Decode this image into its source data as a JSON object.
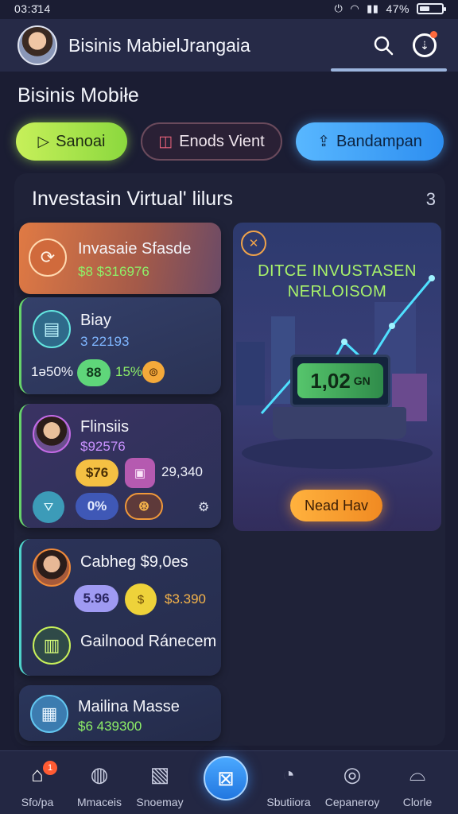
{
  "status_bar": {
    "time": "03:3̄14",
    "battery_text": "47%",
    "battery_level": 0.47
  },
  "app_bar": {
    "title": "Bisinis MabielJrangaia",
    "search_icon": "search-icon",
    "notification_icon": "notification-icon"
  },
  "section_title": "Bisinis Mobiłe",
  "chips": [
    {
      "label": "Sanoai",
      "icon": "play-icon",
      "color": "#a8e64c"
    },
    {
      "label": "Enods Vient",
      "icon": "chart-icon",
      "color": "#6a4a5c"
    },
    {
      "label": "Bandampan",
      "icon": "upload-icon",
      "color": "#3d9cf5"
    }
  ],
  "panel": {
    "title": "Investasin Virtual' lilurs",
    "more": "3",
    "cards": [
      {
        "title": "Invasaie Sfasde",
        "value": "$8 $316976"
      },
      {
        "title": "Biay",
        "value": "3 22193",
        "stats": [
          "1ǝ50%",
          "88",
          "15%"
        ]
      },
      {
        "title": "Flinsiis",
        "value": "$92576",
        "pills": [
          "$76",
          "29,340",
          "0%"
        ]
      },
      {
        "title": "Cabheg $9,0es",
        "pills": [
          "5.96",
          "$3.390"
        ],
        "subtitle": "Gailnood Ránecem"
      },
      {
        "title": "Mailina Masse",
        "value": "$6 439300"
      }
    ],
    "promo": {
      "headline_1": "DITCE INVUSTASEN",
      "headline_2": "NERLOISOM",
      "screen_value": "1,02",
      "screen_unit": "GN",
      "cta": "Nead Hav"
    }
  },
  "bottom_nav": [
    {
      "label": "Sfo/pa",
      "icon": "home-icon",
      "badge": "1"
    },
    {
      "label": "Mmaceis",
      "icon": "wallet-icon"
    },
    {
      "label": "Snoemay",
      "icon": "chart-icon"
    },
    {
      "label": "",
      "icon": "center-action-icon"
    },
    {
      "label": "Sbutiiora",
      "icon": "chat-icon"
    },
    {
      "label": "Cepaneroy",
      "icon": "compass-icon"
    },
    {
      "label": "Clorle",
      "icon": "profile-icon"
    }
  ]
}
